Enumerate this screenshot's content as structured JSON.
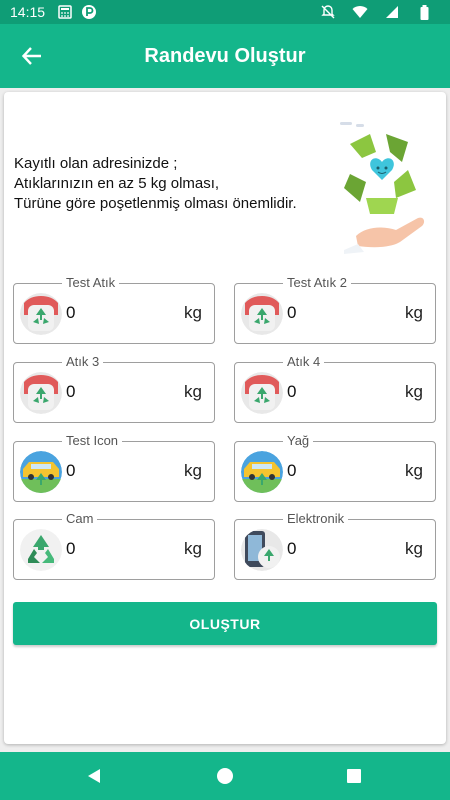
{
  "status_bar": {
    "time": "14:15"
  },
  "app_bar": {
    "title": "Randevu Oluştur"
  },
  "intro": {
    "line1": "Kayıtlı olan adresinizde ;",
    "line2": "Atıklarınızın en az 5 kg olması,",
    "line3": "Türüne göre poşetlenmiş olması önemlidir."
  },
  "fields": [
    {
      "label": "Test Atık",
      "value": "0",
      "unit": "kg",
      "icon": "bag-recycle-icon"
    },
    {
      "label": "Test Atık 2",
      "value": "0",
      "unit": "kg",
      "icon": "bag-recycle-icon"
    },
    {
      "label": "Atık 3",
      "value": "0",
      "unit": "kg",
      "icon": "bag-recycle-icon"
    },
    {
      "label": "Atık 4",
      "value": "0",
      "unit": "kg",
      "icon": "bag-recycle-icon"
    },
    {
      "label": "Test Icon",
      "value": "0",
      "unit": "kg",
      "icon": "car-recycle-icon"
    },
    {
      "label": "Yağ",
      "value": "0",
      "unit": "kg",
      "icon": "car-recycle-icon"
    },
    {
      "label": "Cam",
      "value": "0",
      "unit": "kg",
      "icon": "recycle-icon"
    },
    {
      "label": "Elektronik",
      "value": "0",
      "unit": "kg",
      "icon": "phone-recycle-icon"
    }
  ],
  "create_button": {
    "label": "OLUŞTUR"
  },
  "colors": {
    "primary": "#14b68b",
    "status_bar": "#0f9d76"
  }
}
